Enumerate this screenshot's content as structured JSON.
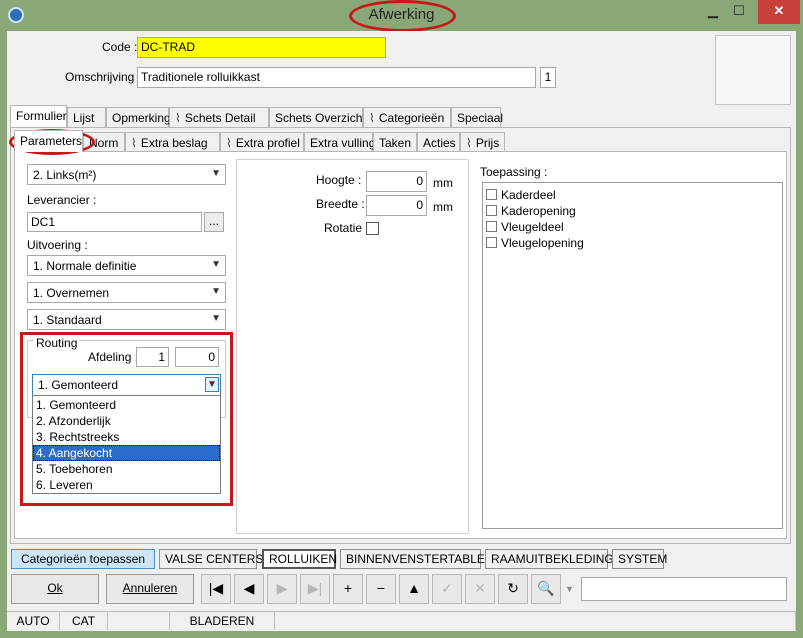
{
  "window": {
    "title": "Afwerking"
  },
  "header": {
    "code_label": "Code :",
    "code_value": "DC-TRAD",
    "omschrijving_label": "Omschrijving :",
    "omschrijving_value": "Traditionele rolluikkast",
    "omschrijving_counter": "1"
  },
  "tabs_main": [
    {
      "label": "Formulier",
      "clip": false,
      "active": true
    },
    {
      "label": "Lijst",
      "clip": false
    },
    {
      "label": "Opmerking",
      "clip": false
    },
    {
      "label": "Schets Detail",
      "clip": true
    },
    {
      "label": "Schets Overzicht",
      "clip": false
    },
    {
      "label": "Categorieën",
      "clip": true
    },
    {
      "label": "Speciaal",
      "clip": false
    }
  ],
  "tabs_sub": [
    {
      "label": "Parameters",
      "active": true
    },
    {
      "label": "Norm"
    },
    {
      "label": "Extra beslag",
      "clip": true
    },
    {
      "label": "Extra profiel",
      "clip": true
    },
    {
      "label": "Extra vulling"
    },
    {
      "label": "Taken"
    },
    {
      "label": "Acties"
    },
    {
      "label": "Prijs",
      "clip": true
    }
  ],
  "left": {
    "combo_unit": "2.  Links(m²)",
    "leverancier_label": "Leverancier :",
    "leverancier_value": "DC1",
    "browse_label": "...",
    "uitvoering_label": "Uitvoering :",
    "combo_uitvoering": "1.  Normale definitie",
    "combo_overnemen": "1.  Overnemen",
    "combo_standaard": "1.  Standaard",
    "routing_label": "Routing",
    "afdeling_label": "Afdeling :",
    "afdeling_value1": "1",
    "afdeling_value2": "0",
    "routing_selected": "1.  Gemonteerd",
    "routing_options": [
      "1.  Gemonteerd",
      "2.  Afzonderlijk",
      "3.  Rechtstreeks",
      "4.  Aangekocht",
      "5.  Toebehoren",
      "6.  Leveren"
    ],
    "routing_highlighted_index": 3
  },
  "middle": {
    "hoogte_label": "Hoogte :",
    "hoogte_value": "0",
    "hoogte_unit": "mm",
    "breedte_label": "Breedte :",
    "breedte_value": "0",
    "breedte_unit": "mm",
    "rotatie_label": "Rotatie"
  },
  "right": {
    "toepassing_label": "Toepassing :",
    "items": [
      "Kaderdeel",
      "Kaderopening",
      "Vleugeldeel",
      "Vleugelopening"
    ]
  },
  "categories_bar": {
    "apply_label": "Categorieën toepassen",
    "buttons": [
      "VALSE CENTERS",
      "ROLLUIKEN",
      "BINNENVENSTERTABLET",
      "RAAMUITBEKLEDING",
      "SYSTEM"
    ],
    "selected": "ROLLUIKEN"
  },
  "actions": {
    "ok_label": "Ok",
    "annuleren_label": "Annuleren"
  },
  "toolbar_icons": [
    {
      "name": "first-record-icon",
      "glyph": "|◀",
      "enabled": true
    },
    {
      "name": "previous-record-icon",
      "glyph": "◀",
      "enabled": true
    },
    {
      "name": "next-record-icon",
      "glyph": "▶",
      "enabled": false
    },
    {
      "name": "last-record-icon",
      "glyph": "▶|",
      "enabled": false
    },
    {
      "name": "add-record-icon",
      "glyph": "+",
      "enabled": true
    },
    {
      "name": "delete-record-icon",
      "glyph": "−",
      "enabled": true
    },
    {
      "name": "move-up-icon",
      "glyph": "▲",
      "enabled": true
    },
    {
      "name": "confirm-icon",
      "glyph": "✓",
      "enabled": false
    },
    {
      "name": "cancel-icon",
      "glyph": "✕",
      "enabled": false
    },
    {
      "name": "refresh-icon",
      "glyph": "↻",
      "enabled": true
    },
    {
      "name": "binoculars-icon",
      "glyph": "🔍",
      "enabled": true
    }
  ],
  "statusbar": {
    "cells": [
      "AUTO",
      "CAT",
      "",
      "BLADEREN",
      ""
    ]
  }
}
